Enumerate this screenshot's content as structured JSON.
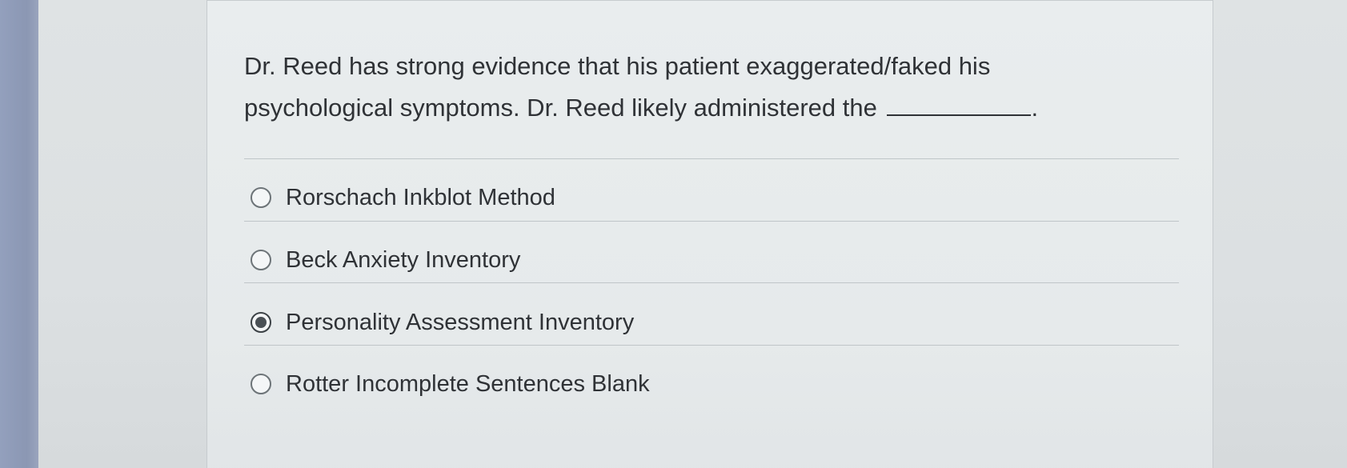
{
  "question": {
    "line1": "Dr. Reed has strong evidence that his patient exaggerated/faked his",
    "line2": "psychological symptoms. Dr. Reed likely administered the",
    "blank_end": "."
  },
  "options": [
    {
      "label": "Rorschach Inkblot Method",
      "selected": false
    },
    {
      "label": "Beck Anxiety Inventory",
      "selected": false
    },
    {
      "label": "Personality Assessment Inventory",
      "selected": true
    },
    {
      "label": "Rotter Incomplete Sentences Blank",
      "selected": false
    }
  ]
}
